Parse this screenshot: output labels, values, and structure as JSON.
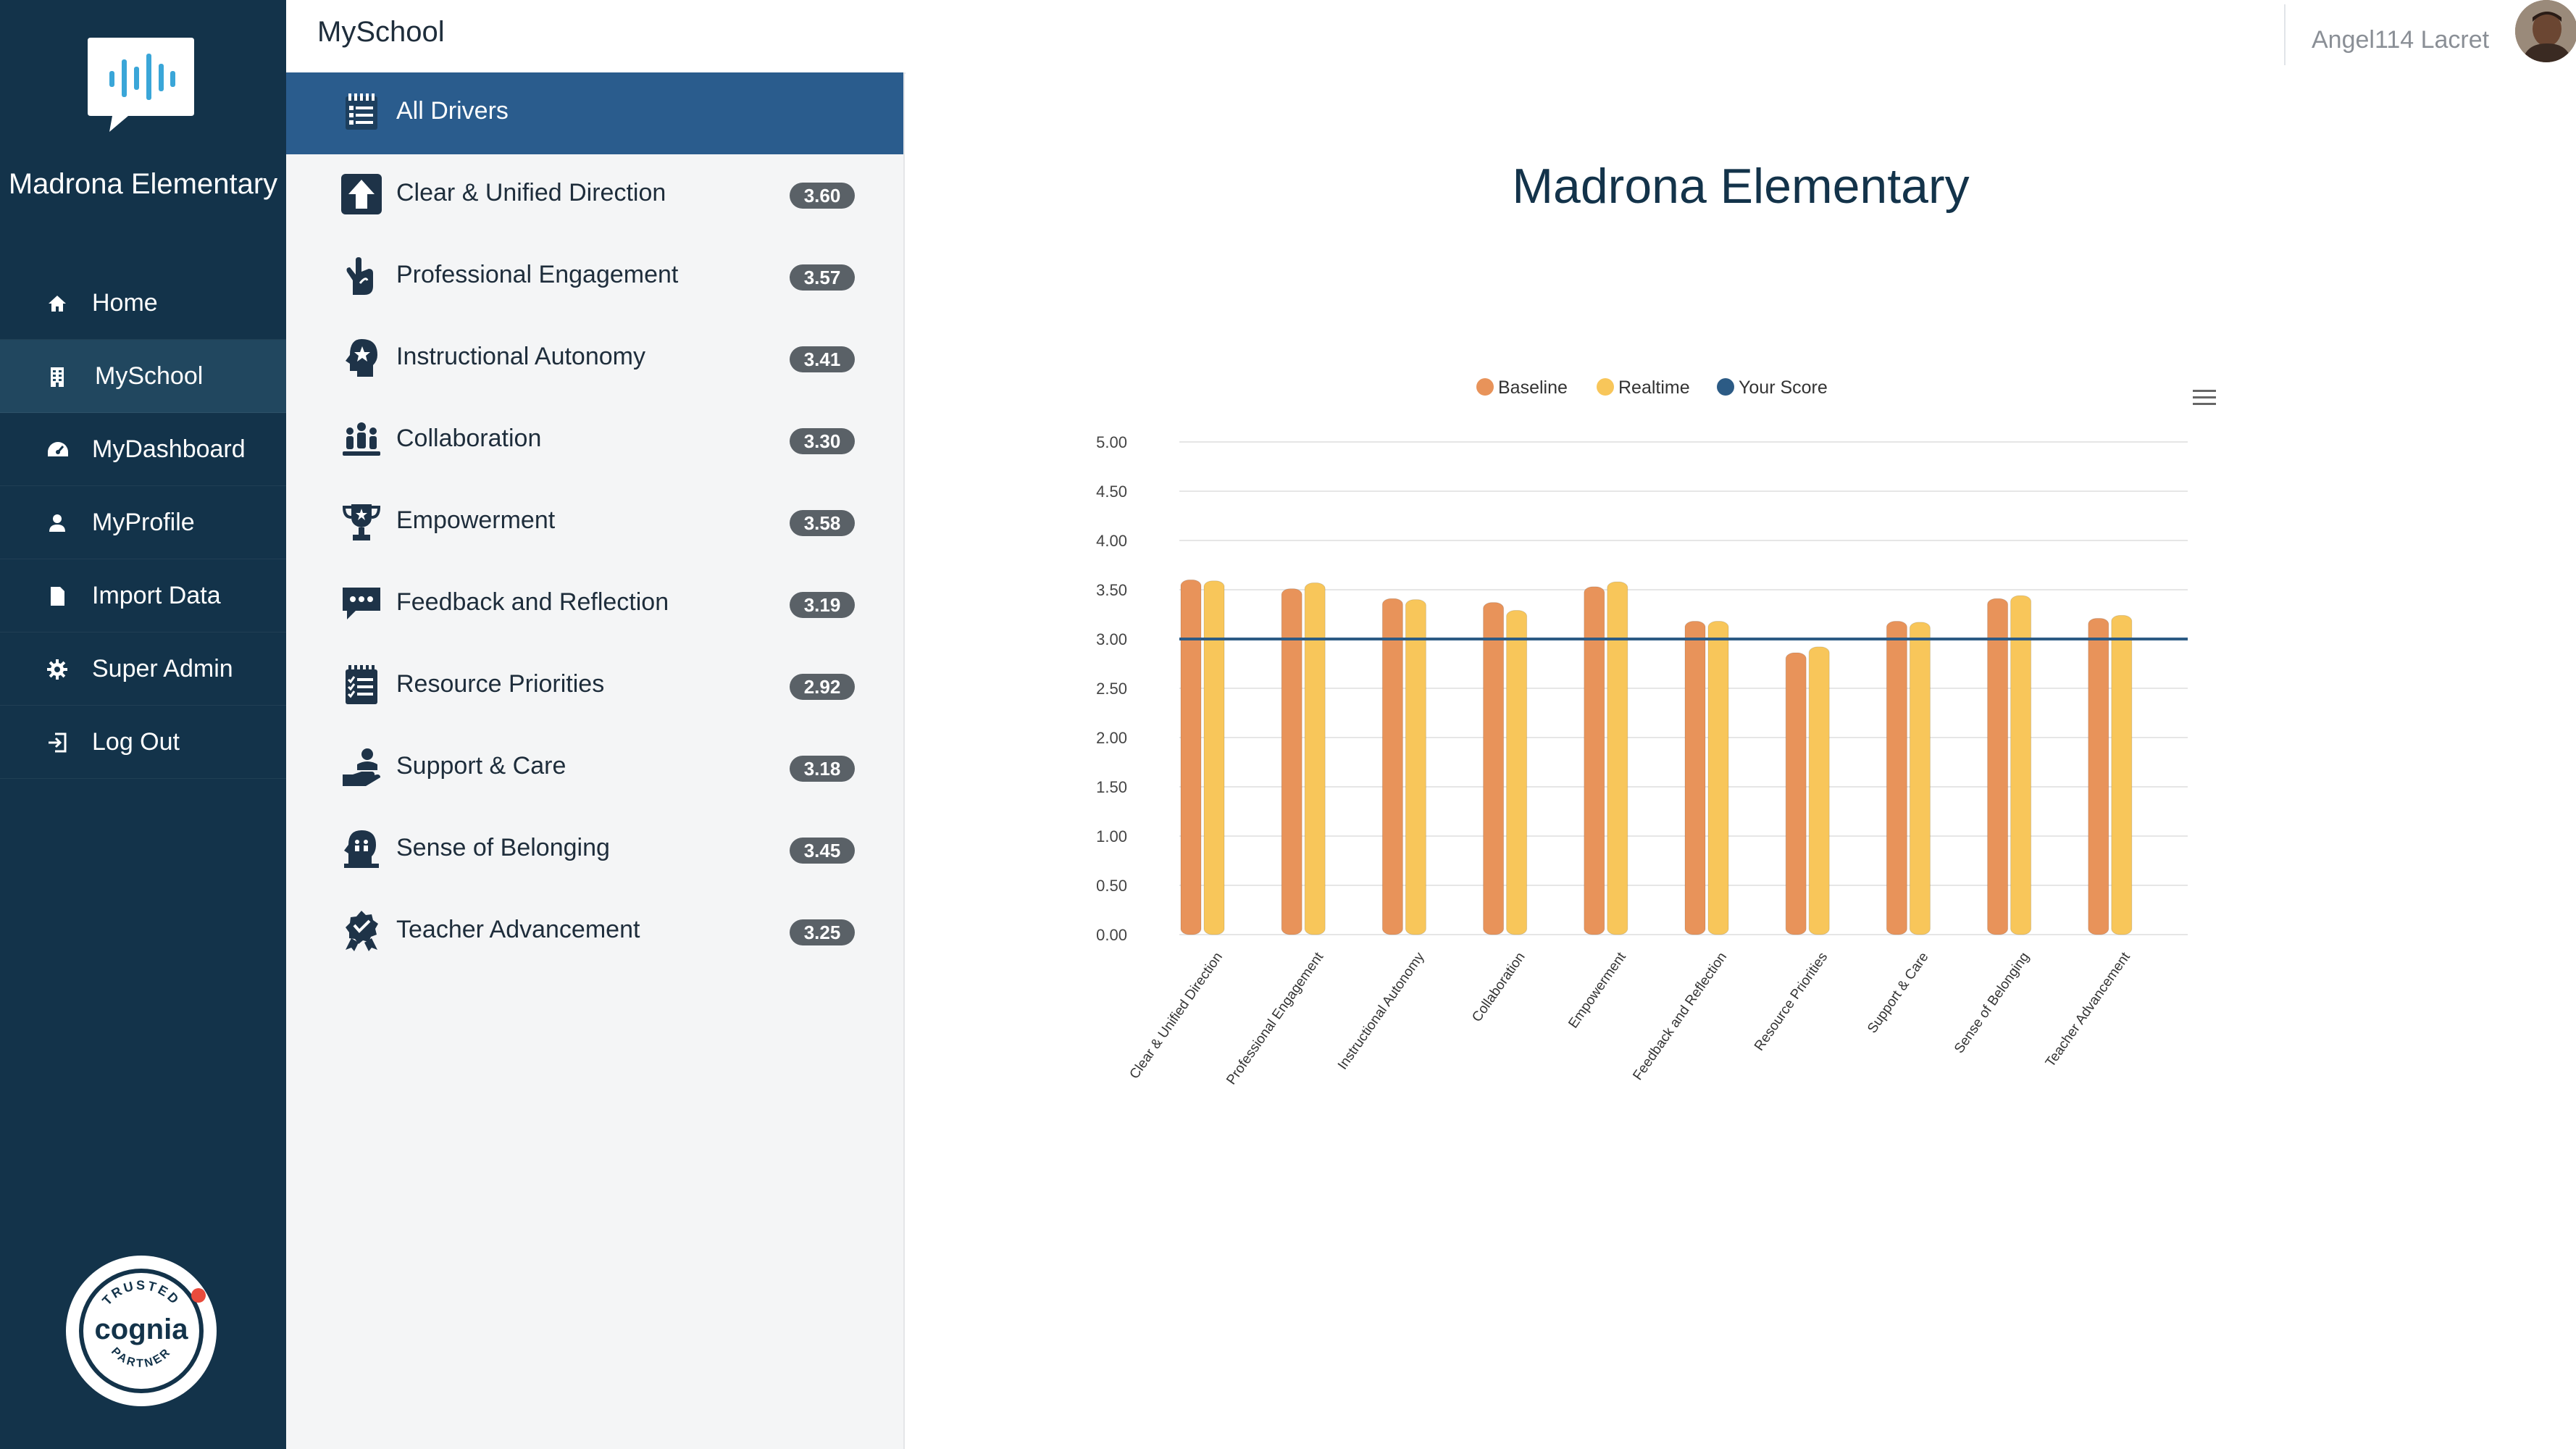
{
  "sidebar": {
    "school_name": "Madrona Elementary",
    "nav": [
      {
        "label": "Home",
        "icon": "home-icon",
        "active": false
      },
      {
        "label": "MySchool",
        "icon": "building-icon",
        "active": true
      },
      {
        "label": "MyDashboard",
        "icon": "dashboard-icon",
        "active": false
      },
      {
        "label": "MyProfile",
        "icon": "user-icon",
        "active": false
      },
      {
        "label": "Import Data",
        "icon": "file-icon",
        "active": false
      },
      {
        "label": "Super Admin",
        "icon": "gear-icon",
        "active": false
      },
      {
        "label": "Log Out",
        "icon": "logout-icon",
        "active": false
      }
    ],
    "badge": {
      "top": "TRUSTED",
      "brand": "cognia",
      "bottom": "PARTNER"
    }
  },
  "topbar": {
    "title": "MySchool",
    "user_name": "Angel114 Lacret"
  },
  "drivers": [
    {
      "label": "All Drivers",
      "score": null,
      "icon": "all-drivers-icon",
      "active": true
    },
    {
      "label": "Clear & Unified Direction",
      "score": "3.60",
      "icon": "arrow-up-icon"
    },
    {
      "label": "Professional Engagement",
      "score": "3.57",
      "icon": "hand-icon"
    },
    {
      "label": "Instructional Autonomy",
      "score": "3.41",
      "icon": "head-star-icon"
    },
    {
      "label": "Collaboration",
      "score": "3.30",
      "icon": "group-icon"
    },
    {
      "label": "Empowerment",
      "score": "3.58",
      "icon": "trophy-icon"
    },
    {
      "label": "Feedback and Reflection",
      "score": "3.19",
      "icon": "chat-icon"
    },
    {
      "label": "Resource Priorities",
      "score": "2.92",
      "icon": "checklist-icon"
    },
    {
      "label": "Support & Care",
      "score": "3.18",
      "icon": "care-hand-icon"
    },
    {
      "label": "Sense of Belonging",
      "score": "3.45",
      "icon": "belonging-icon"
    },
    {
      "label": "Teacher Advancement",
      "score": "3.25",
      "icon": "award-icon"
    }
  ],
  "chart_data": {
    "type": "bar",
    "title": "Madrona Elementary",
    "categories": [
      "Clear & Unified Direction",
      "Professional Engagement",
      "Instructional Autonomy",
      "Collaboration",
      "Empowerment",
      "Feedback and Reflection",
      "Resource Priorities",
      "Support & Care",
      "Sense of Belonging",
      "Teacher Advancement"
    ],
    "series": [
      {
        "name": "Baseline",
        "color": "#e8935a",
        "values": [
          3.6,
          3.51,
          3.41,
          3.37,
          3.53,
          3.18,
          2.86,
          3.18,
          3.41,
          3.21
        ]
      },
      {
        "name": "Realtime",
        "color": "#f8c65a",
        "values": [
          3.59,
          3.57,
          3.4,
          3.29,
          3.58,
          3.18,
          2.92,
          3.17,
          3.44,
          3.24
        ]
      },
      {
        "name": "Your Score",
        "color": "#2c5b85",
        "type": "line",
        "values": [
          3.0,
          3.0,
          3.0,
          3.0,
          3.0,
          3.0,
          3.0,
          3.0,
          3.0,
          3.0
        ]
      }
    ],
    "ylim": [
      0,
      5
    ],
    "yticks": [
      "0.00",
      "0.50",
      "1.00",
      "1.50",
      "2.00",
      "2.50",
      "3.00",
      "3.50",
      "4.00",
      "4.50",
      "5.00"
    ],
    "grid": true,
    "legend": "top-center"
  }
}
